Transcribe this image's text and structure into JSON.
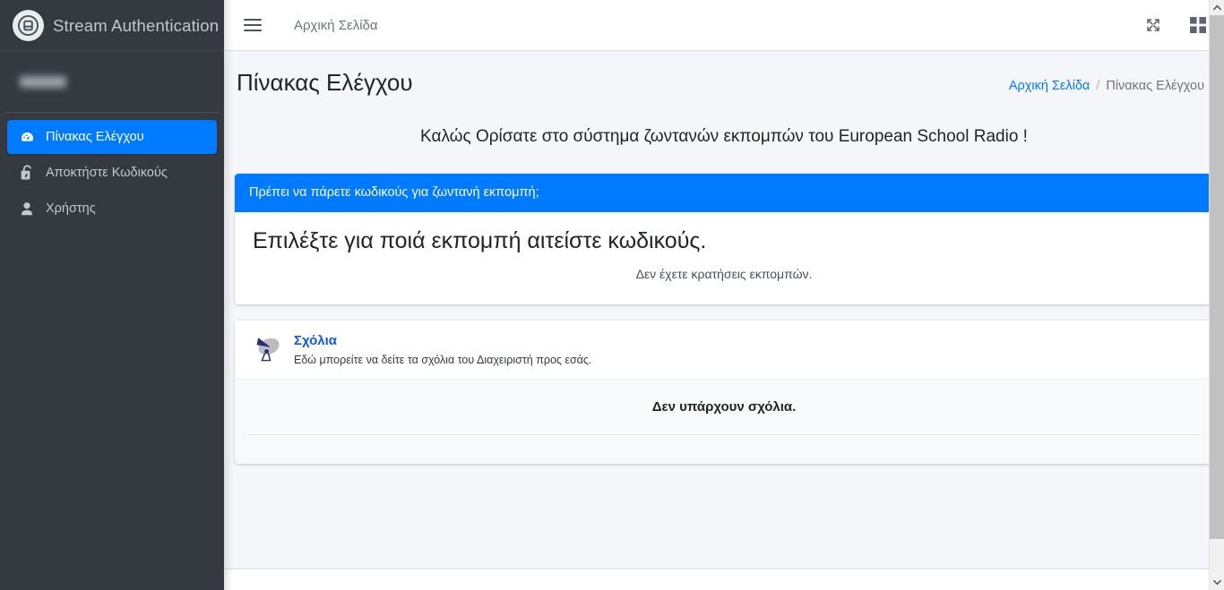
{
  "sidebar": {
    "brand": {
      "logo_icon": "app-logo-icon",
      "title": "Stream Authentication"
    },
    "user": {
      "name_redacted": ""
    },
    "items": [
      {
        "label": "Πίνακας Ελέγχου",
        "icon": "dashboard-icon",
        "active": true
      },
      {
        "label": "Αποκτήστε Κωδικούς",
        "icon": "unlock-icon",
        "active": false
      },
      {
        "label": "Χρήστης",
        "icon": "user-icon",
        "active": false
      }
    ]
  },
  "topbar": {
    "menu_icon": "hamburger-icon",
    "home_link": "Αρχική Σελίδα",
    "fullscreen_icon": "fullscreen-expand-icon",
    "widgets_icon": "grid-widgets-icon"
  },
  "content": {
    "page_title": "Πίνακας Ελέγχου",
    "breadcrumb": {
      "home": "Αρχική Σελίδα",
      "separator": "/",
      "current": "Πίνακας Ελέγχου"
    },
    "welcome_message": "Καλώς Ορίσατε στο σύστημα ζωντανών εκπομπών του European School Radio !",
    "codes_card": {
      "header": "Πρέπει να πάρετε κωδικούς για ζωντανή εκπομπή;",
      "heading": "Επιλέξτε για ποιά εκπομπή αιτείστε κωδικούς.",
      "empty_text": "Δεν έχετε κρατήσεις εκπομπών."
    },
    "comments_card": {
      "icon": "satellite-dish-icon",
      "title": "Σχόλια",
      "subtitle": "Εδώ μπορείτε να δείτε τα σχόλια του Διαχειριστή προς εσάς.",
      "empty_text": "Δεν υπάρχουν σχόλια."
    }
  },
  "scrollbar": {
    "up_icon": "chevron-up-icon",
    "down_icon": "chevron-down-icon"
  },
  "colors": {
    "accent_blue": "#007bff",
    "sidebar_dark": "#343a40",
    "content_bg": "#f4f6f9",
    "link_blue": "#0b5ed7"
  }
}
